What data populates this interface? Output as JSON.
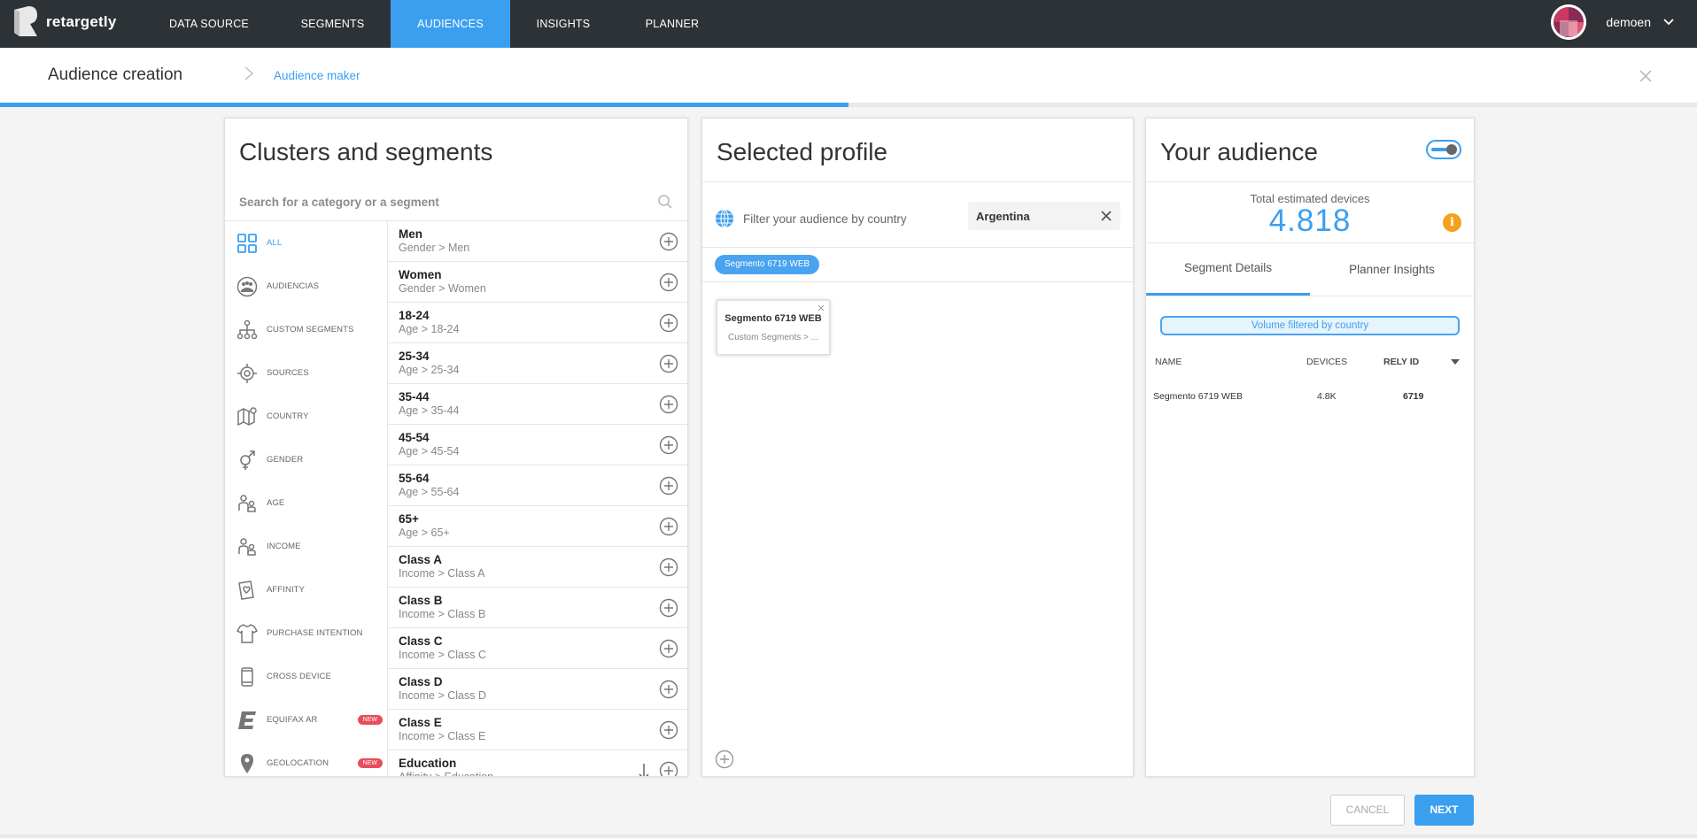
{
  "nav": {
    "logo_text": "retargetly",
    "items": [
      {
        "label": "DATA SOURCE"
      },
      {
        "label": "SEGMENTS"
      },
      {
        "label": "AUDIENCES"
      },
      {
        "label": "INSIGHTS"
      },
      {
        "label": "PLANNER"
      }
    ],
    "active_index": 2,
    "username": "demoen"
  },
  "header": {
    "title": "Audience creation",
    "crumb": "Audience maker",
    "progress": 0.5
  },
  "clusters": {
    "title": "Clusters and segments",
    "search_placeholder": "Search for a category or a segment",
    "categories": [
      {
        "label": "ALL",
        "icon": "grid-icon"
      },
      {
        "label": "AUDIENCIAS",
        "icon": "audience-icon"
      },
      {
        "label": "CUSTOM SEGMENTS",
        "icon": "hierarchy-icon"
      },
      {
        "label": "SOURCES",
        "icon": "target-icon"
      },
      {
        "label": "COUNTRY",
        "icon": "map-icon"
      },
      {
        "label": "GENDER",
        "icon": "gender-icon"
      },
      {
        "label": "AGE",
        "icon": "age-icon"
      },
      {
        "label": "INCOME",
        "icon": "income-icon"
      },
      {
        "label": "AFFINITY",
        "icon": "affinity-icon"
      },
      {
        "label": "PURCHASE INTENTION",
        "icon": "shirt-icon"
      },
      {
        "label": "CROSS DEVICE",
        "icon": "phone-icon"
      },
      {
        "label": "EQUIFAX AR",
        "icon": "equifax-icon",
        "badge": "NEW"
      },
      {
        "label": "GEOLOCATION",
        "icon": "pin-icon",
        "badge": "NEW"
      }
    ],
    "segments": [
      {
        "name": "Men",
        "path": "Gender > Men"
      },
      {
        "name": "Women",
        "path": "Gender > Women"
      },
      {
        "name": "18-24",
        "path": "Age > 18-24"
      },
      {
        "name": "25-34",
        "path": "Age > 25-34"
      },
      {
        "name": "35-44",
        "path": "Age > 35-44"
      },
      {
        "name": "45-54",
        "path": "Age > 45-54"
      },
      {
        "name": "55-64",
        "path": "Age > 55-64"
      },
      {
        "name": "65+",
        "path": "Age > 65+"
      },
      {
        "name": "Class A",
        "path": "Income > Class A"
      },
      {
        "name": "Class B",
        "path": "Income > Class B"
      },
      {
        "name": "Class C",
        "path": "Income > Class C"
      },
      {
        "name": "Class D",
        "path": "Income > Class D"
      },
      {
        "name": "Class E",
        "path": "Income > Class E"
      },
      {
        "name": "Education",
        "path": "Affinity > Education"
      }
    ]
  },
  "profile": {
    "title": "Selected profile",
    "filter_label": "Filter your audience by country",
    "country": "Argentina",
    "chip": "Segmento 6719 WEB",
    "card_title": "Segmento 6719 WEB",
    "card_sub": "Custom Segments > ..."
  },
  "audience": {
    "title": "Your audience",
    "total_label": "Total estimated devices",
    "total_value": "4.818",
    "info_glyph": "i",
    "tabs": [
      "Segment Details",
      "Planner Insights"
    ],
    "volume_note": "Volume filtered by country",
    "columns": {
      "name": "NAME",
      "devices": "DEVICES",
      "rely": "RELY ID"
    },
    "rows": [
      {
        "name": "Segmento 6719 WEB",
        "devices": "4.8K",
        "rely": "6719"
      }
    ]
  },
  "footer": {
    "cancel": "CANCEL",
    "next": "NEXT"
  },
  "colors": {
    "accent": "#3b9ff0",
    "nav_bg": "#2d3236",
    "badge": "#e84d5b",
    "info": "#f3a21b"
  }
}
